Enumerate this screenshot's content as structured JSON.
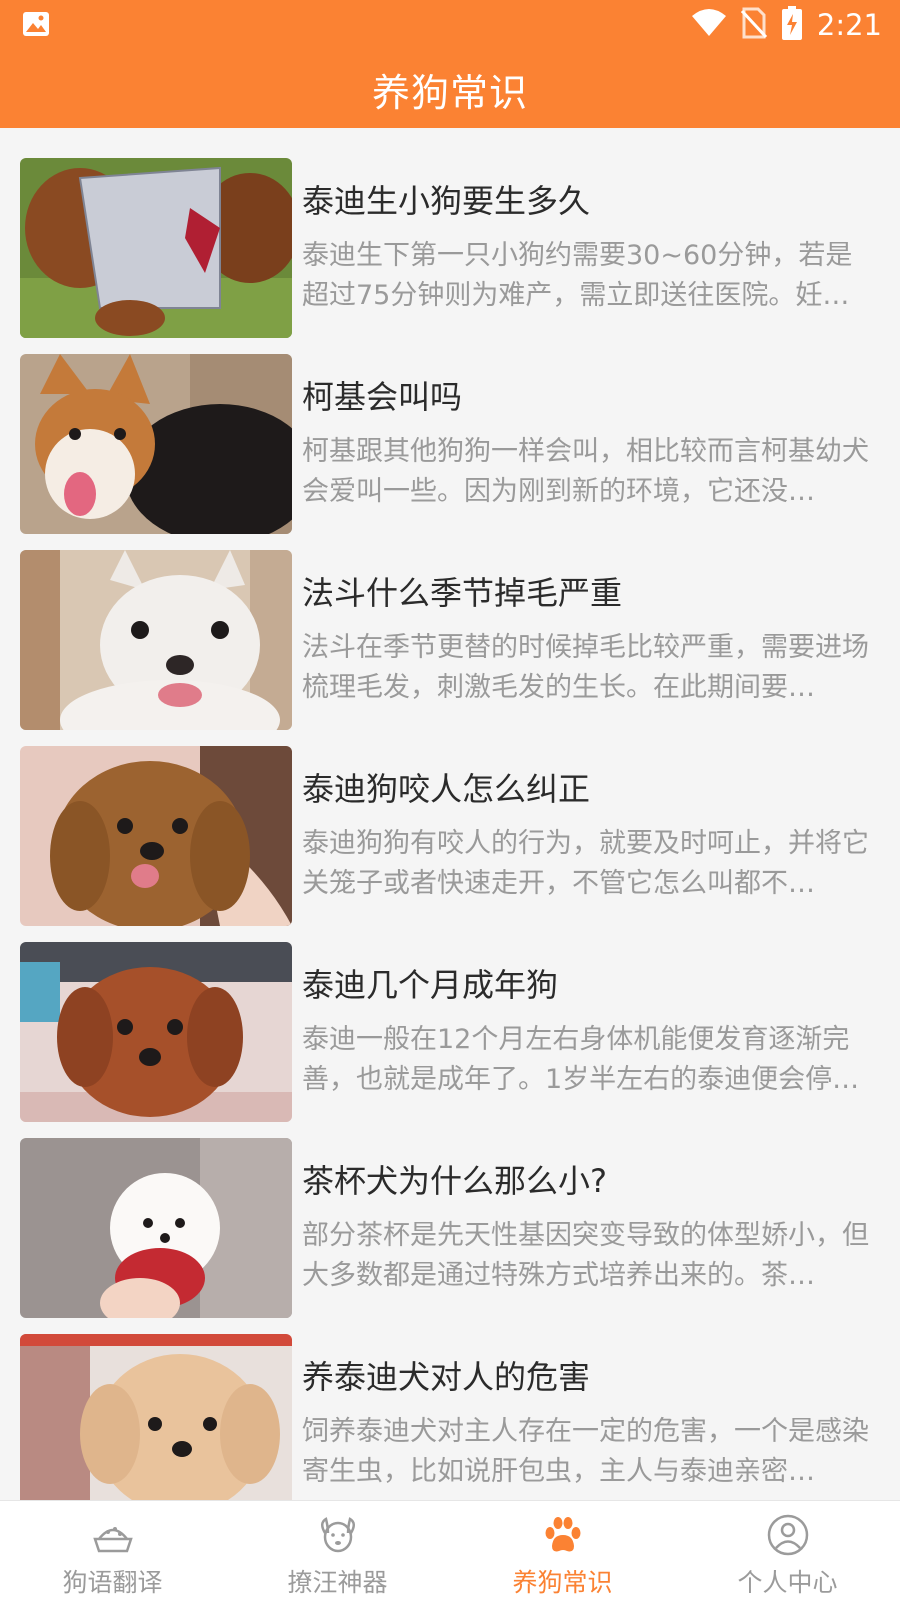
{
  "status_bar": {
    "time": "2:21",
    "icons": [
      "image-icon",
      "wifi-icon",
      "no-sim-icon",
      "battery-charging-icon"
    ]
  },
  "header": {
    "title": "养狗常识"
  },
  "articles": [
    {
      "title": "泰迪生小狗要生多久",
      "summary": "泰迪生下第一只小狗约需要30~60分钟，若是超过75分钟则为难产，需立即送往医院。妊…"
    },
    {
      "title": "柯基会叫吗",
      "summary": "柯基跟其他狗狗一样会叫，相比较而言柯基幼犬会爱叫一些。因为刚到新的环境，它还没…"
    },
    {
      "title": "法斗什么季节掉毛严重",
      "summary": "法斗在季节更替的时候掉毛比较严重，需要进场梳理毛发，刺激毛发的生长。在此期间要…"
    },
    {
      "title": "泰迪狗咬人怎么纠正",
      "summary": "泰迪狗狗有咬人的行为，就要及时呵止，并将它关笼子或者快速走开，不管它怎么叫都不…"
    },
    {
      "title": "泰迪几个月成年狗",
      "summary": "泰迪一般在12个月左右身体机能便发育逐渐完善，也就是成年了。1岁半左右的泰迪便会停…"
    },
    {
      "title": "茶杯犬为什么那么小?",
      "summary": "部分茶杯是先天性基因突变导致的体型娇小，但大多数都是通过特殊方式培养出来的。茶…"
    },
    {
      "title": "养泰迪犬对人的危害",
      "summary": "饲养泰迪犬对主人存在一定的危害，一个是感染寄生虫，比如说肝包虫，主人与泰迪亲密…"
    }
  ],
  "bottom_nav": {
    "items": [
      {
        "label": "狗语翻译",
        "icon": "dog-bowl-icon",
        "active": false
      },
      {
        "label": "撩汪神器",
        "icon": "dog-face-icon",
        "active": false
      },
      {
        "label": "养狗常识",
        "icon": "paw-icon",
        "active": true
      },
      {
        "label": "个人中心",
        "icon": "user-icon",
        "active": false
      }
    ]
  },
  "colors": {
    "accent": "#fb8233",
    "background": "#f5f5f5",
    "title_text": "#2b2b2b",
    "summary_text": "#9a9a9a",
    "nav_inactive": "#9b9b9b"
  }
}
